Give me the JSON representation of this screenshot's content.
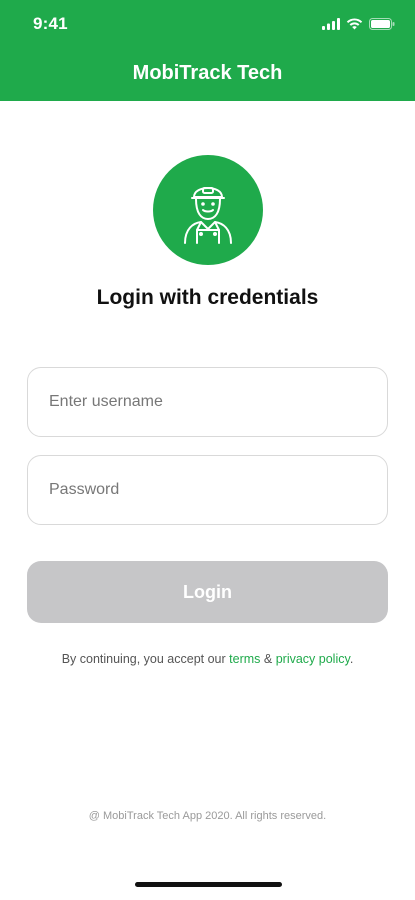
{
  "status_bar": {
    "time": "9:41",
    "icons": [
      "signal-icon",
      "wifi-icon",
      "battery-icon"
    ]
  },
  "header": {
    "title": "MobiTrack Tech",
    "color": "#1faa4b"
  },
  "avatar": {
    "icon": "technician-icon"
  },
  "page_title": "Login with credentials",
  "form": {
    "username_placeholder": "Enter username",
    "username_value": "",
    "password_placeholder": "Password",
    "password_value": "",
    "login_label": "Login"
  },
  "legal": {
    "prefix": "By continuing, you accept our ",
    "terms_link": "terms",
    "joiner": " & ",
    "privacy_link": "privacy policy",
    "suffix": "."
  },
  "footer": {
    "copyright": "@ MobiTrack Tech App 2020. All rights reserved."
  },
  "colors": {
    "brand_green": "#1faa4b",
    "disabled_button": "#c6c6c8"
  }
}
